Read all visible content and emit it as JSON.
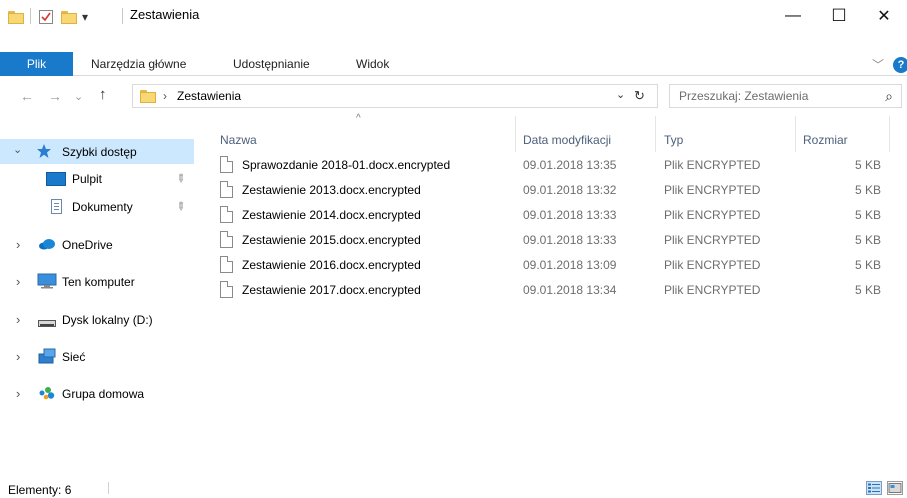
{
  "window": {
    "title": "Zestawienia",
    "controls": {
      "minimize": "—",
      "maximize": "☐",
      "close": "✕"
    },
    "qat_dropdown": "▾"
  },
  "ribbon": {
    "tabs": [
      "Plik",
      "Narzędzia główne",
      "Udostępnianie",
      "Widok"
    ],
    "collapse_glyph": "﹀",
    "help_glyph": "?"
  },
  "address": {
    "back": "←",
    "forward": "→",
    "recent": "⌄",
    "up": "↑",
    "separator": "›",
    "path": "Zestawienia",
    "dropdown": "⌄",
    "refresh": "↻"
  },
  "search": {
    "placeholder": "Przeszukaj: Zestawienia",
    "icon": "⌕"
  },
  "nav": {
    "items": [
      {
        "label": "Szybki dostęp",
        "icon": "star-icon",
        "expanded": true,
        "selected": true
      },
      {
        "label": "Pulpit",
        "icon": "desktop-icon",
        "pinned": true
      },
      {
        "label": "Dokumenty",
        "icon": "documents-icon",
        "pinned": true
      },
      {
        "label": "OneDrive",
        "icon": "onedrive-icon"
      },
      {
        "label": "Ten komputer",
        "icon": "computer-icon"
      },
      {
        "label": "Dysk lokalny (D:)",
        "icon": "drive-icon"
      },
      {
        "label": "Sieć",
        "icon": "network-icon"
      },
      {
        "label": "Grupa domowa",
        "icon": "homegroup-icon"
      }
    ],
    "expand_glyph": "›",
    "expanded_glyph": "⌄",
    "pin_glyph": "📌"
  },
  "list": {
    "columns": [
      "Nazwa",
      "Data modyfikacji",
      "Typ",
      "Rozmiar"
    ],
    "sort_indicator": "^",
    "files": [
      {
        "name": "Sprawozdanie 2018-01.docx.encrypted",
        "date": "09.01.2018 13:35",
        "type": "Plik ENCRYPTED",
        "size": "5 KB"
      },
      {
        "name": "Zestawienie 2013.docx.encrypted",
        "date": "09.01.2018 13:32",
        "type": "Plik ENCRYPTED",
        "size": "5 KB"
      },
      {
        "name": "Zestawienie 2014.docx.encrypted",
        "date": "09.01.2018 13:33",
        "type": "Plik ENCRYPTED",
        "size": "5 KB"
      },
      {
        "name": "Zestawienie 2015.docx.encrypted",
        "date": "09.01.2018 13:33",
        "type": "Plik ENCRYPTED",
        "size": "5 KB"
      },
      {
        "name": "Zestawienie 2016.docx.encrypted",
        "date": "09.01.2018 13:09",
        "type": "Plik ENCRYPTED",
        "size": "5 KB"
      },
      {
        "name": "Zestawienie 2017.docx.encrypted",
        "date": "09.01.2018 13:34",
        "type": "Plik ENCRYPTED",
        "size": "5 KB"
      }
    ]
  },
  "status": {
    "text": "Elementy: 6"
  },
  "colors": {
    "accent": "#1979ca",
    "selection": "#cce8ff",
    "header_text": "#4c607a",
    "muted_text": "#6d6d6d"
  }
}
